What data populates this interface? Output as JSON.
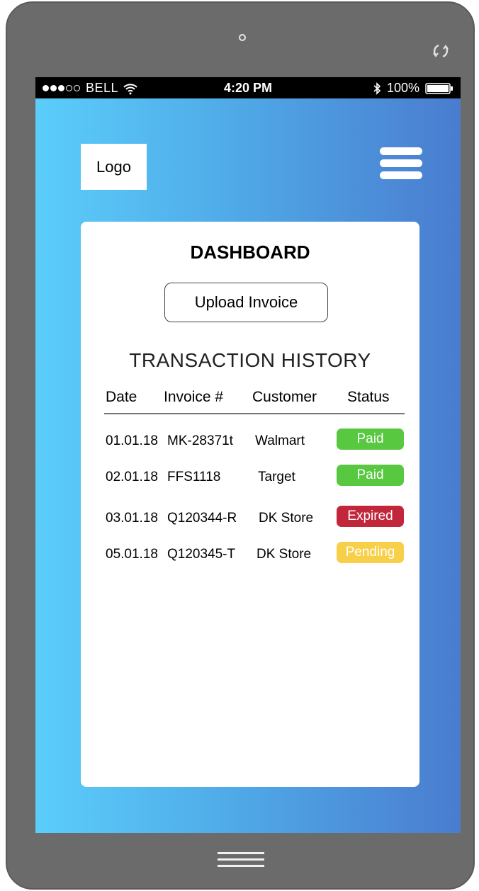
{
  "status_bar": {
    "carrier": "BELL",
    "time": "4:20 PM",
    "battery": "100%"
  },
  "header": {
    "logo": "Logo"
  },
  "dashboard": {
    "title": "DASHBOARD",
    "upload_button": "Upload Invoice",
    "section_title": "TRANSACTION HISTORY",
    "columns": [
      "Date",
      "Invoice #",
      "Customer",
      "Status"
    ],
    "rows": [
      {
        "date": "01.01.18",
        "invoice": "MK-28371t",
        "customer": "Walmart",
        "status": "Paid",
        "status_color": "#57c840"
      },
      {
        "date": "02.01.18",
        "invoice": "FFS1118",
        "customer": "Target",
        "status": "Paid",
        "status_color": "#57c840"
      },
      {
        "date": "03.01.18",
        "invoice": "Q120344-R",
        "customer": "DK Store",
        "status": "Expired",
        "status_color": "#c1263b"
      },
      {
        "date": "05.01.18",
        "invoice": "Q120345-T",
        "customer": "DK Store",
        "status": "Pending",
        "status_color": "#f7cf48"
      }
    ]
  },
  "icons": {
    "status_bar": [
      "signal-dots-icon",
      "wifi-icon",
      "bluetooth-icon",
      "battery-icon"
    ],
    "header": [
      "menu-icon"
    ],
    "device": [
      "camera-icon",
      "rotate-icon",
      "home-icon"
    ]
  },
  "colors": {
    "gradient_start": "#5bcdfb",
    "gradient_end": "#4a7ccf",
    "paid": "#57c840",
    "expired": "#c1263b",
    "pending": "#f7cf48"
  }
}
